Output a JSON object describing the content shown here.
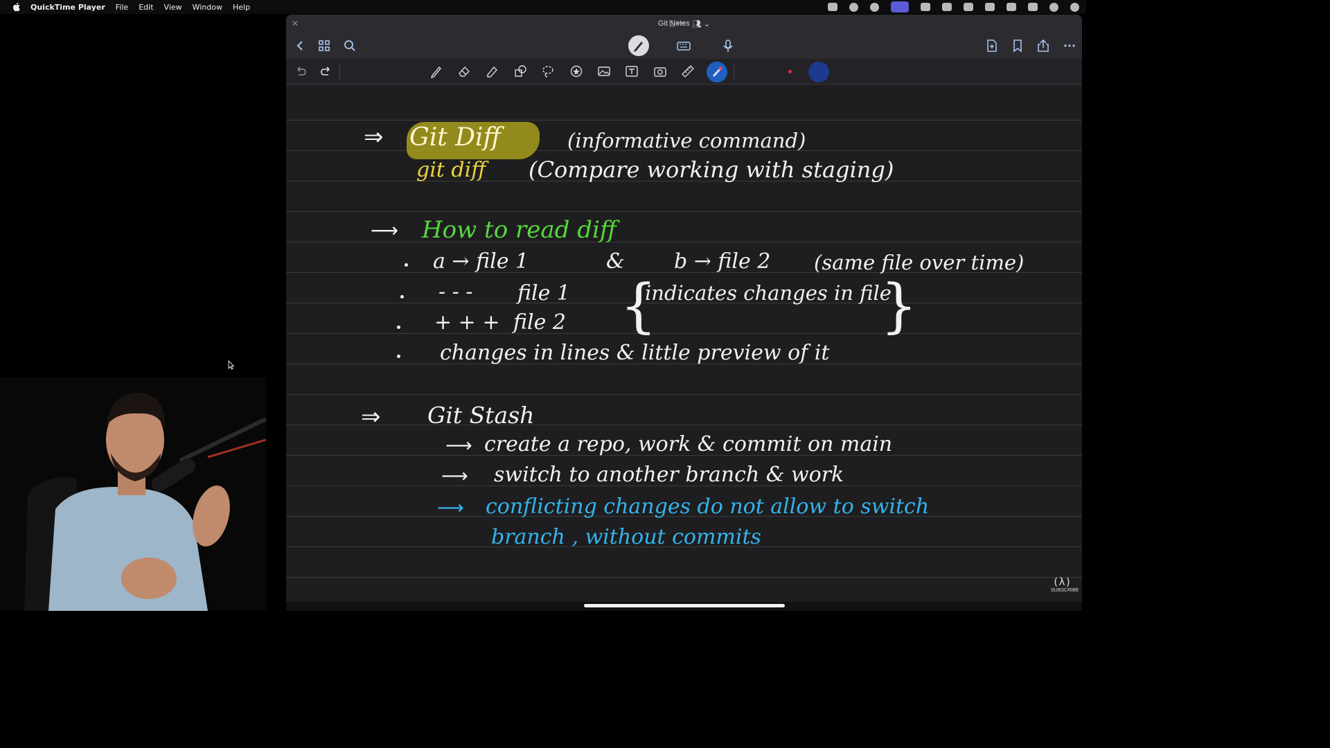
{
  "menubar": {
    "app_name": "QuickTime Player",
    "items": [
      "File",
      "Edit",
      "View",
      "Window",
      "Help"
    ]
  },
  "window": {
    "title": "Git Notes",
    "colors": {
      "page_bg": "#1e1e20",
      "toolbar_bg": "#2c2c30",
      "accent": "#1f5fbf"
    }
  },
  "toolbar": {
    "top_icons": [
      "back-icon",
      "grid-icon",
      "search-icon",
      "pen-mode-icon",
      "keyboard-icon",
      "microphone-icon",
      "add-page-icon",
      "bookmark-icon",
      "share-icon",
      "more-icon"
    ],
    "tool_icons": [
      "undo-icon",
      "redo-icon",
      "pen-icon",
      "eraser-icon",
      "highlighter-icon",
      "shapes-icon",
      "lasso-icon",
      "sticker-icon",
      "image-icon",
      "textbox-icon",
      "camera-icon",
      "ruler-icon",
      "laser-pointer-icon"
    ]
  },
  "notes": {
    "git_diff_title": "Git  Diff",
    "git_diff_note": "(informative command)",
    "git_diff_cmd": "git  diff",
    "git_diff_cmd_note": "(Compare  working  with  staging)",
    "how_to_read": "How  to  read  diff",
    "line_a": "a → file 1",
    "amp": "&",
    "line_b": "b → file 2",
    "same_file": "(same file over time)",
    "dashes": "- - -",
    "file1": "file 1",
    "indicates": "indicates  changes  in file",
    "pluses": "+ + +",
    "file2": "file 2",
    "changes_in_lines": "changes  in  lines  &  little  preview  of  it",
    "git_stash_title": "Git  Stash",
    "stash_1": "create  a  repo,  work  &  commit  on  main",
    "stash_2": "switch  to  another  branch  &  work",
    "stash_3": "conflicting  changes  do  not  allow  to  switch",
    "stash_3b": "branch ,  without   commits"
  },
  "logo": {
    "label": "SUBSCRIBE",
    "mark": "(λ)"
  }
}
